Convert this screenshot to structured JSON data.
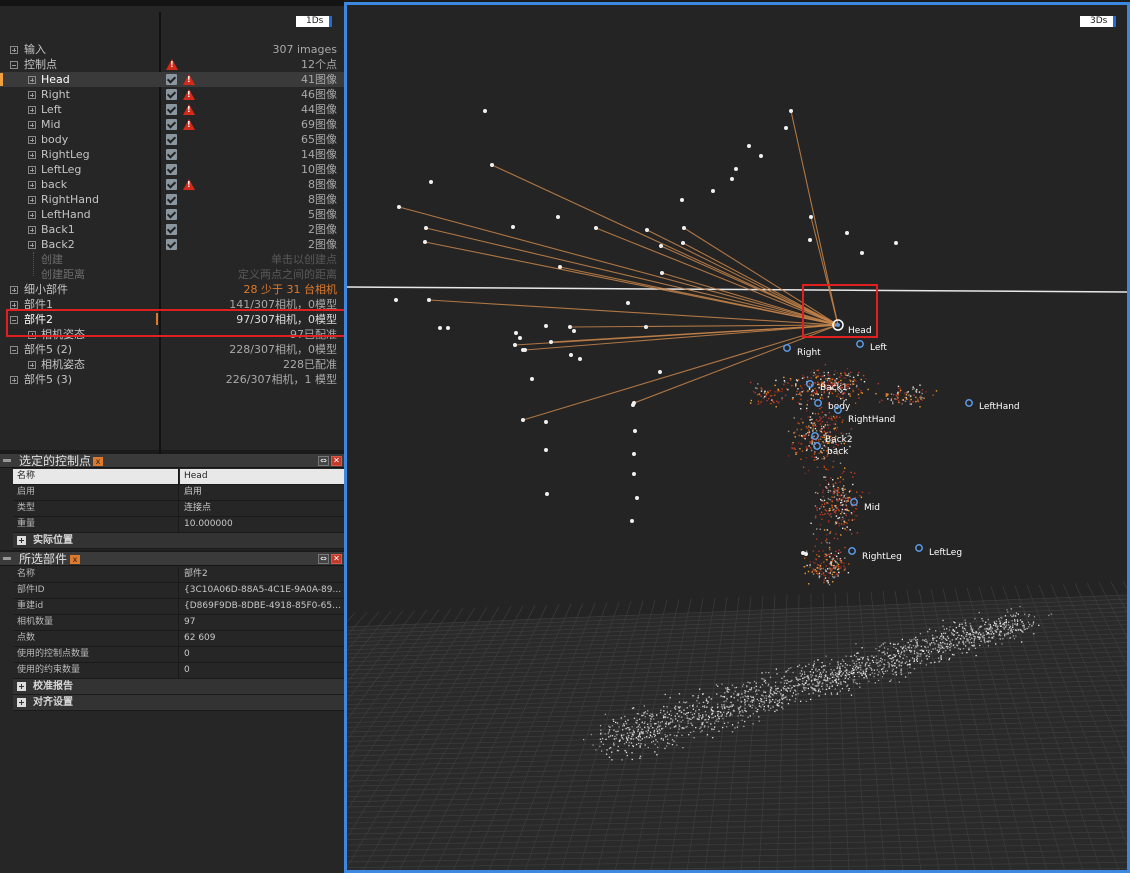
{
  "left_panel": {
    "mode_badge": "1Ds",
    "tree": [
      {
        "label": "输入",
        "value": "307 images"
      },
      {
        "label": "控制点",
        "value": "12个点"
      },
      {
        "label": "Head",
        "value": "41图像"
      },
      {
        "label": "Right",
        "value": "46图像"
      },
      {
        "label": "Left",
        "value": "44图像"
      },
      {
        "label": "Mid",
        "value": "69图像"
      },
      {
        "label": "body",
        "value": "65图像"
      },
      {
        "label": "RightLeg",
        "value": "14图像"
      },
      {
        "label": "LeftLeg",
        "value": "10图像"
      },
      {
        "label": "back",
        "value": "8图像"
      },
      {
        "label": "RightHand",
        "value": "8图像"
      },
      {
        "label": "LeftHand",
        "value": "5图像"
      },
      {
        "label": "Back1",
        "value": "2图像"
      },
      {
        "label": "Back2",
        "value": "2图像"
      },
      {
        "label": "创建",
        "value": "单击以创建点"
      },
      {
        "label": "创建距离",
        "value": "定义两点之间的距离"
      },
      {
        "label": "细小部件",
        "value": "28 少于 31 台相机"
      },
      {
        "label": "部件1",
        "value": "141/307相机，0模型"
      },
      {
        "label": "部件2",
        "value": "97/307相机，0模型"
      },
      {
        "label": "相机姿态",
        "value": "97已配准"
      },
      {
        "label": "部件5 (2)",
        "value": "228/307相机，0模型"
      },
      {
        "label": "相机姿态",
        "value": "228已配准"
      },
      {
        "label": "部件5 (3)",
        "value": "226/307相机，1 模型"
      }
    ]
  },
  "control_point_panel": {
    "title": "选定的控制点",
    "rows": [
      {
        "key": "名称",
        "value": "Head"
      },
      {
        "key": "启用",
        "value": "启用"
      },
      {
        "key": "类型",
        "value": "连接点"
      },
      {
        "key": "重量",
        "value": "10.000000"
      }
    ],
    "groups": [
      "实际位置"
    ]
  },
  "component_panel": {
    "title": "所选部件",
    "rows": [
      {
        "key": "名称",
        "value": "部件2"
      },
      {
        "key": "部件ID",
        "value": "{3C10A06D-88A5-4C1E-9A0A-89..."
      },
      {
        "key": "重建id",
        "value": "{D869F9DB-8DBE-4918-85F0-655..."
      },
      {
        "key": "相机数量",
        "value": "97"
      },
      {
        "key": "点数",
        "value": "62 609"
      },
      {
        "key": "使用的控制点数量",
        "value": "0"
      },
      {
        "key": "使用的约束数量",
        "value": "0"
      }
    ],
    "groups": [
      "校准报告",
      "对齐设置"
    ]
  },
  "viewport": {
    "mode_badge": "3Ds",
    "point_labels": [
      "Head",
      "Right",
      "Left",
      "Back1",
      "body",
      "RightHand",
      "LeftHand",
      "Back2",
      "back",
      "Mid",
      "RightLeg",
      "LeftLeg"
    ],
    "colors": {
      "frame": "#3c88e0",
      "ray": "#c8854a",
      "highlight": "#e02020",
      "control_point": "#5a9be8"
    }
  }
}
